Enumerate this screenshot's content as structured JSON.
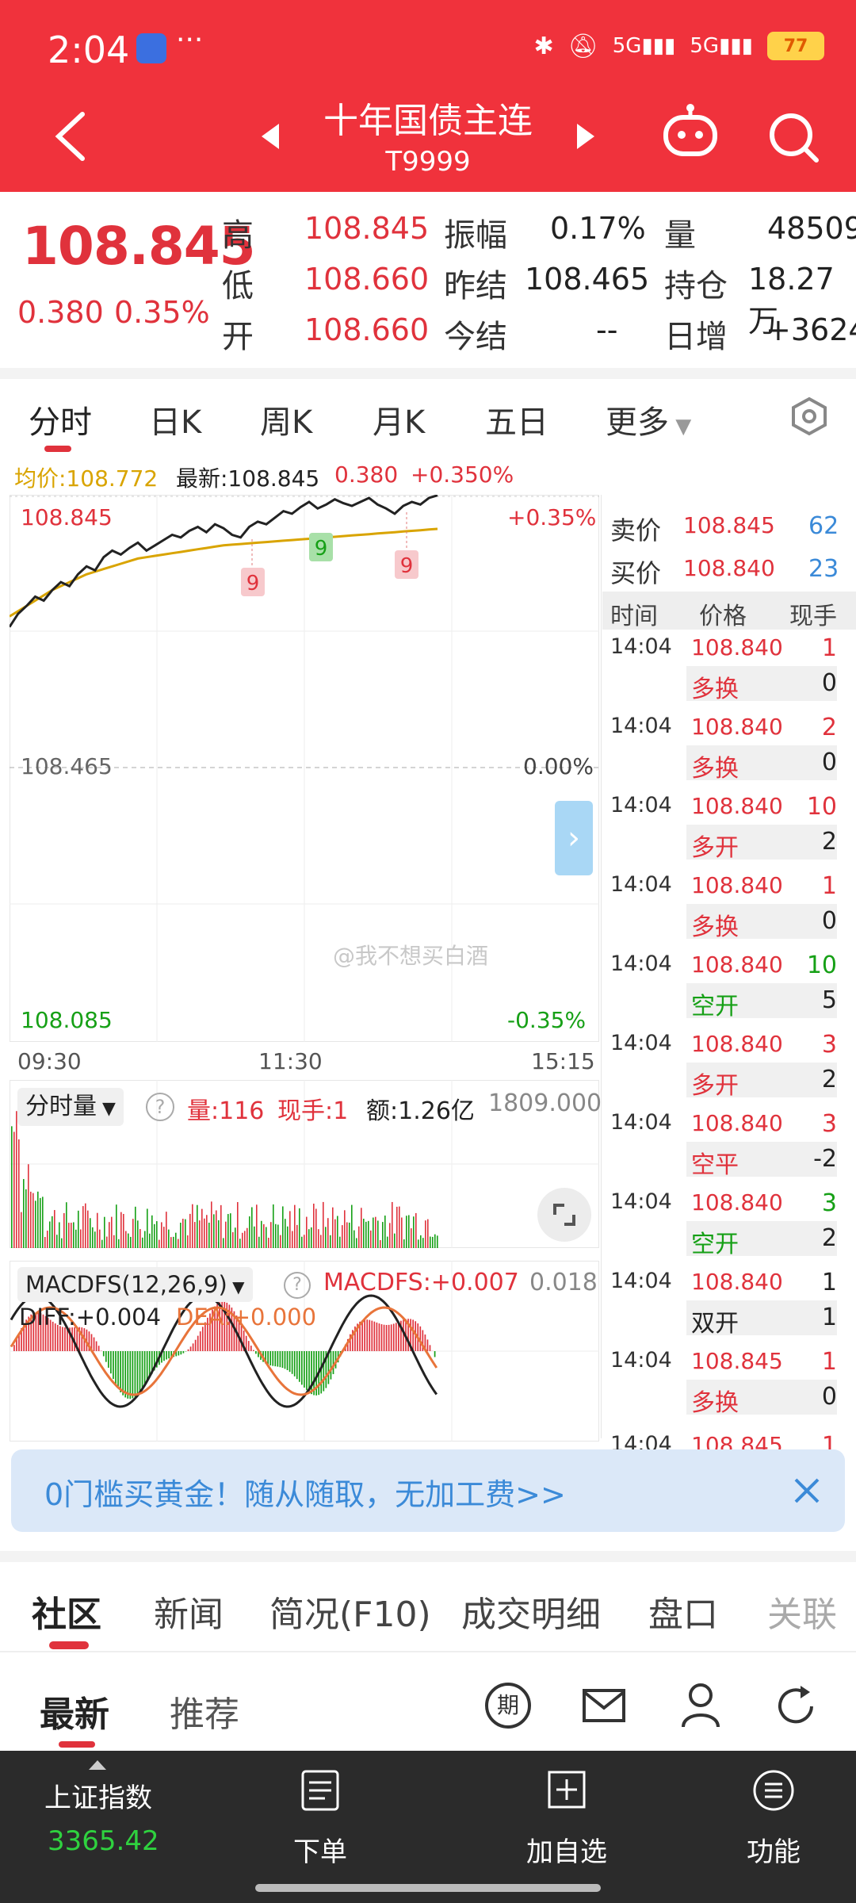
{
  "status": {
    "time": "2:04",
    "more": "···",
    "battery": "77"
  },
  "header": {
    "title": "十年国债主连",
    "code": "T9999"
  },
  "quote": {
    "last": "108.845",
    "change": "0.380",
    "change_pct": "0.35%",
    "high_label": "高",
    "high": "108.845",
    "low_label": "低",
    "low": "108.660",
    "open_label": "开",
    "open": "108.660",
    "amplitude_label": "振幅",
    "amplitude": "0.17%",
    "prev_settle_label": "昨结",
    "prev_settle": "108.465",
    "settle_label": "今结",
    "settle": "--",
    "volume_label": "量",
    "volume": "48509",
    "open_interest_label": "持仓",
    "open_interest": "18.27万",
    "daily_inc_label": "日增",
    "daily_inc": "+3624"
  },
  "tabs": [
    "分时",
    "日K",
    "周K",
    "月K",
    "五日",
    "更多"
  ],
  "chart": {
    "avg_label": "均价:108.772",
    "latest_label": "最新:108.845",
    "change": "0.380",
    "change_pct": "+0.350%",
    "y_top": "108.845",
    "y_top_pct": "+0.35%",
    "y_mid": "108.465",
    "y_mid_pct": "0.00%",
    "y_bot": "108.085",
    "y_bot_pct": "-0.35%",
    "x_start": "09:30",
    "x_mid": "11:30",
    "x_end": "15:15",
    "marker_9a": "9",
    "marker_9b": "9",
    "marker_9c": "9",
    "watermark": "@我不想买白酒",
    "price_line": [
      0.02,
      0.12,
      0.18,
      0.25,
      0.22,
      0.3,
      0.36,
      0.33,
      0.42,
      0.48,
      0.45,
      0.55,
      0.6,
      0.57,
      0.62,
      0.66,
      0.6,
      0.64,
      0.68,
      0.72,
      0.7,
      0.75,
      0.78,
      0.74,
      0.8,
      0.77,
      0.72,
      0.7,
      0.78,
      0.82,
      0.8,
      0.85,
      0.9,
      0.88,
      0.93,
      0.97,
      0.92,
      0.95,
      0.99,
      0.96,
      0.94,
      0.97,
      1.0,
      0.95,
      0.92,
      0.88,
      0.94,
      0.97,
      0.95,
      1.0,
      1.02
    ],
    "avg_line": [
      0.1,
      0.14,
      0.18,
      0.22,
      0.26,
      0.3,
      0.33,
      0.36,
      0.39,
      0.42,
      0.44,
      0.46,
      0.48,
      0.5,
      0.52,
      0.54,
      0.55,
      0.56,
      0.57,
      0.58,
      0.59,
      0.6,
      0.61,
      0.62,
      0.63,
      0.64,
      0.645,
      0.65,
      0.655,
      0.66,
      0.665,
      0.67,
      0.675,
      0.68,
      0.685,
      0.69,
      0.695,
      0.7,
      0.705,
      0.71,
      0.715,
      0.72,
      0.725,
      0.73,
      0.735,
      0.74,
      0.745,
      0.75,
      0.755,
      0.76,
      0.765
    ]
  },
  "volume_panel": {
    "selector": "分时量",
    "volume": "量:116",
    "hand": "现手:1",
    "amount": "额:1.26亿",
    "max": "1809.000"
  },
  "macd_panel": {
    "selector": "MACDFS(12,26,9)",
    "macd": "MACDFS:+0.007",
    "max": "0.018",
    "diff": "DIFF:+0.004",
    "dea": "DEA:+0.000"
  },
  "order_book": {
    "ask_label": "卖价",
    "ask_price": "108.845",
    "ask_qty": "62",
    "bid_label": "买价",
    "bid_price": "108.840",
    "bid_qty": "23",
    "col_time": "时间",
    "col_price": "价格",
    "col_hand": "现手",
    "trades": [
      {
        "time": "14:04",
        "price": "108.840",
        "qty": "1",
        "qty_color": "#e0323c",
        "type": "多换",
        "type_color": "#e0323c",
        "oi": "0"
      },
      {
        "time": "14:04",
        "price": "108.840",
        "qty": "2",
        "qty_color": "#e0323c",
        "type": "多换",
        "type_color": "#e0323c",
        "oi": "0"
      },
      {
        "time": "14:04",
        "price": "108.840",
        "qty": "10",
        "qty_color": "#e0323c",
        "type": "多开",
        "type_color": "#e0323c",
        "oi": "2"
      },
      {
        "time": "14:04",
        "price": "108.840",
        "qty": "1",
        "qty_color": "#e0323c",
        "type": "多换",
        "type_color": "#e0323c",
        "oi": "0"
      },
      {
        "time": "14:04",
        "price": "108.840",
        "qty": "10",
        "qty_color": "#16a016",
        "type": "空开",
        "type_color": "#16a016",
        "oi": "5"
      },
      {
        "time": "14:04",
        "price": "108.840",
        "qty": "3",
        "qty_color": "#e0323c",
        "type": "多开",
        "type_color": "#e0323c",
        "oi": "2"
      },
      {
        "time": "14:04",
        "price": "108.840",
        "qty": "3",
        "qty_color": "#e0323c",
        "type": "空平",
        "type_color": "#e0323c",
        "oi": "-2"
      },
      {
        "time": "14:04",
        "price": "108.840",
        "qty": "3",
        "qty_color": "#16a016",
        "type": "空开",
        "type_color": "#16a016",
        "oi": "2"
      },
      {
        "time": "14:04",
        "price": "108.840",
        "qty": "1",
        "qty_color": "#222222",
        "type": "双开",
        "type_color": "#222222",
        "oi": "1"
      },
      {
        "time": "14:04",
        "price": "108.845",
        "qty": "1",
        "qty_color": "#e0323c",
        "type": "多换",
        "type_color": "#e0323c",
        "oi": "0"
      }
    ],
    "partial_time": "14:04",
    "partial_price": "108.845",
    "partial_qty": "1"
  },
  "banner": {
    "text": "0门槛买黄金！随从随取，无加工费>>"
  },
  "bottom_tabs": [
    "社区",
    "新闻",
    "简况(F10)",
    "成交明细",
    "盘口",
    "关联"
  ],
  "sub_tabs": [
    "最新",
    "推荐"
  ],
  "futures_icon_label": "期",
  "bottom_nav": {
    "index_label": "上证指数",
    "index_value": "3365.42",
    "order": "下单",
    "add": "加自选",
    "func": "功能"
  },
  "colors": {
    "brand": "#f0323c",
    "up": "#e0323c",
    "down": "#16a016",
    "avg": "#d9a400"
  }
}
